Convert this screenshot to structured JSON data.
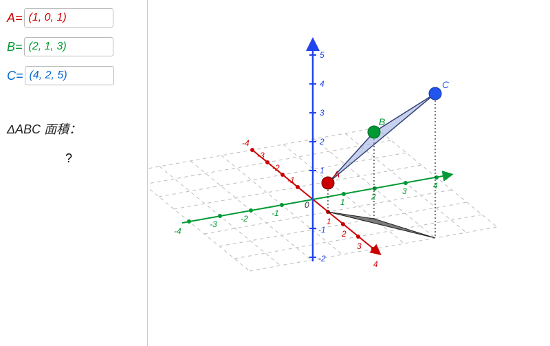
{
  "points": {
    "A": {
      "label": "A=",
      "value": "(1, 0, 1)",
      "color": "#cc0000",
      "mark": "A"
    },
    "B": {
      "label": "B=",
      "value": "(2, 1, 3)",
      "color": "#009933",
      "mark": "B"
    },
    "C": {
      "label": "C=",
      "value": "(4, 2, 5)",
      "color": "#0066cc",
      "mark": "C"
    }
  },
  "area": {
    "label": "ΔABC 面積：",
    "value": "?"
  },
  "axes": {
    "x": {
      "ticks": [
        -4,
        -3,
        -2,
        -1,
        1,
        2,
        3,
        4
      ],
      "label4": "4",
      "labelNeg4": "-4",
      "label3": "3"
    },
    "y": {
      "ticks": [
        -4,
        -3,
        -2,
        -1,
        1,
        2,
        3,
        4
      ]
    },
    "z": {
      "posTicks": [
        1,
        2,
        3,
        4,
        5
      ],
      "negTicks": [
        -1,
        -2
      ]
    }
  },
  "origin_label": "0"
}
